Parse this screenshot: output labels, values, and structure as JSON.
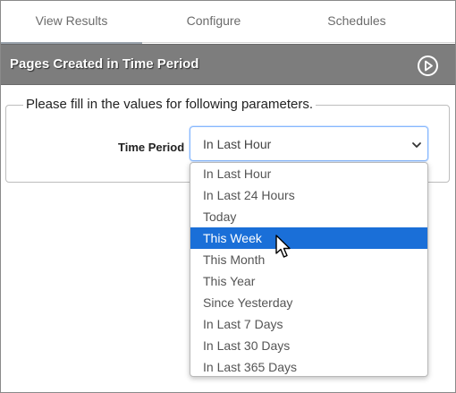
{
  "tabs": [
    {
      "label": "View Results",
      "active": true
    },
    {
      "label": "Configure",
      "active": false
    },
    {
      "label": "Schedules",
      "active": false
    }
  ],
  "report": {
    "title": "Pages Created in Time Period",
    "run_icon": "play-circle-icon"
  },
  "parameters": {
    "legend": "Please fill in the values for following parameters.",
    "time_period": {
      "label": "Time Period",
      "selected_value": "In Last Hour",
      "highlighted_option": "This Week",
      "options": [
        "In Last Hour",
        "In Last 24 Hours",
        "Today",
        "This Week",
        "This Month",
        "This Year",
        "Since Yesterday",
        "In Last 7 Days",
        "In Last 30 Days",
        "In Last 365 Days"
      ]
    }
  },
  "colors": {
    "titlebar_bg": "#7d7d7d",
    "highlight": "#1a6fd8",
    "focus_border": "#86b7fe"
  },
  "icons": {
    "dropdown_arrow": "chevron-down-icon",
    "pointer": "mouse-pointer-icon"
  }
}
